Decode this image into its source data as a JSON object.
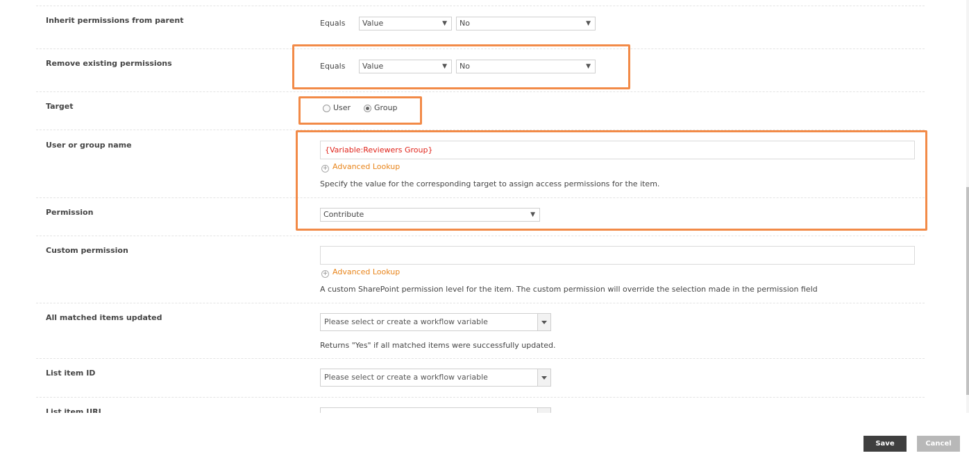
{
  "rows": {
    "inherit": {
      "label": "Inherit permissions from parent",
      "operator": "Equals",
      "type_value": "Value",
      "value": "No"
    },
    "remove": {
      "label": "Remove existing permissions",
      "operator": "Equals",
      "type_value": "Value",
      "value": "No"
    },
    "target": {
      "label": "Target",
      "option_user": "User",
      "option_group": "Group",
      "selected": "Group"
    },
    "user_group": {
      "label": "User or group name",
      "value": "{Variable:Reviewers Group}",
      "lookup": "Advanced Lookup",
      "help": "Specify the value for the corresponding target to assign access permissions for the item."
    },
    "permission": {
      "label": "Permission",
      "value": "Contribute"
    },
    "custom_permission": {
      "label": "Custom permission",
      "value": "",
      "lookup": "Advanced Lookup",
      "help": "A custom SharePoint permission level for the item. The custom permission will override the selection made in the permission field"
    },
    "all_matched": {
      "label": "All matched items updated",
      "placeholder": "Please select or create a workflow variable",
      "help": "Returns \"Yes\" if all matched items were successfully updated."
    },
    "list_item_id": {
      "label": "List item ID",
      "placeholder": "Please select or create a workflow variable"
    },
    "list_item_url": {
      "label": "List item URL"
    }
  },
  "icons": {
    "dropdown": "chevron-down-icon",
    "lookup": "plus-circle-icon"
  },
  "colors": {
    "highlight": "#f28a47",
    "lookup_link": "#e8841a",
    "variable_text": "#e0241b",
    "save_bg": "#3f3f3f",
    "cancel_bg": "#b8b8b8"
  },
  "footer": {
    "save_label": "Save",
    "cancel_label": "Cancel"
  }
}
